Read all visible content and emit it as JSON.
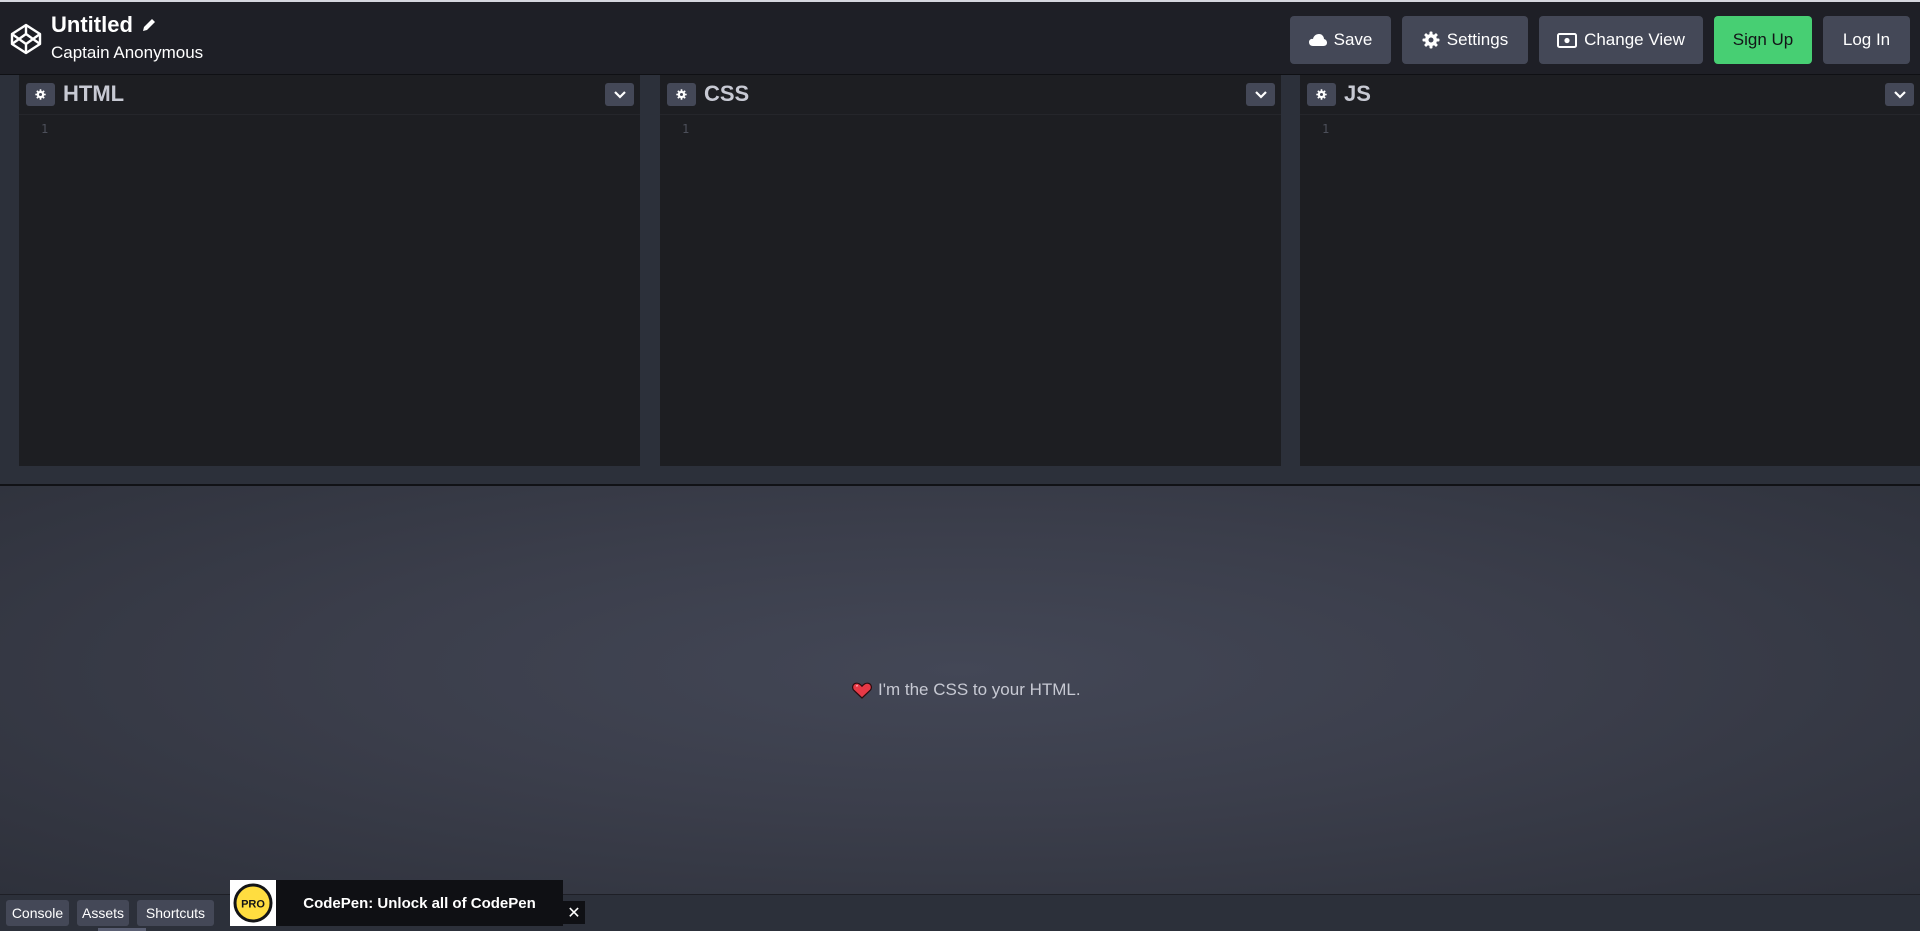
{
  "header": {
    "title": "Untitled",
    "author": "Captain Anonymous",
    "buttons": {
      "save": "Save",
      "settings": "Settings",
      "change_view": "Change View",
      "sign_up": "Sign Up",
      "log_in": "Log In"
    }
  },
  "editors": [
    {
      "title": "HTML",
      "line_number": "1"
    },
    {
      "title": "CSS",
      "line_number": "1"
    },
    {
      "title": "JS",
      "line_number": "1"
    }
  ],
  "preview": {
    "text": "I'm the CSS to your HTML."
  },
  "footer": {
    "console": "Console",
    "assets": "Assets",
    "shortcuts": "Shortcuts"
  },
  "promo": {
    "badge": "PRO",
    "text": "CodePen: Unlock all of CodePen",
    "close": "✕"
  },
  "colors": {
    "header_bg": "#1e1f26",
    "editor_bg": "#1d1e22",
    "button_bg": "#444857",
    "signup_green": "#47cf73",
    "promo_badge": "#ffdd40"
  }
}
